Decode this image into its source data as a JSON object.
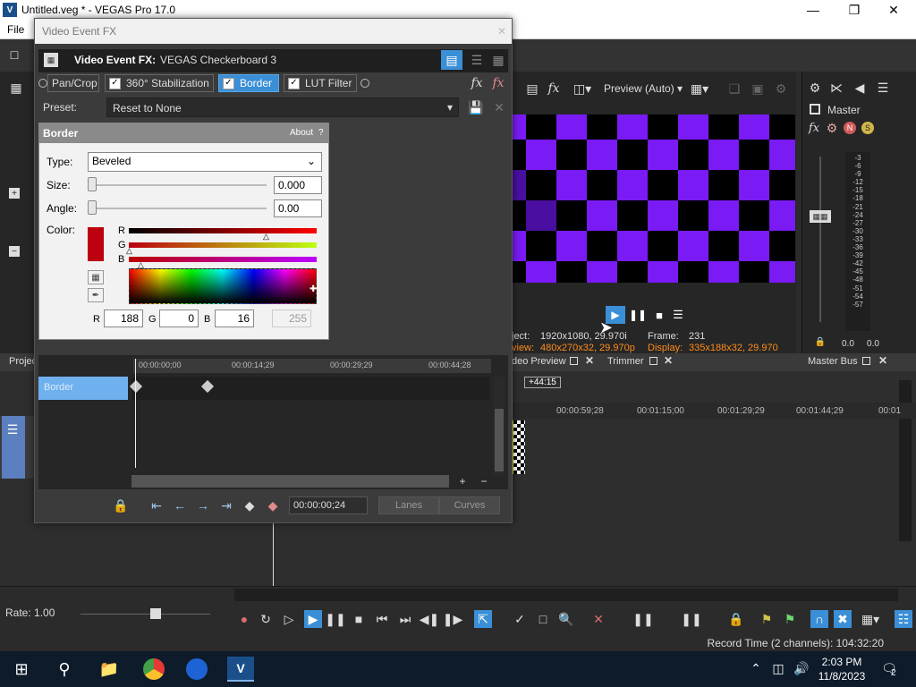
{
  "window": {
    "title": "Untitled.veg * - VEGAS Pro 17.0",
    "app_icon": "V",
    "minimize": "—",
    "maximize": "❐",
    "close": "✕"
  },
  "menu": {
    "file": "File"
  },
  "dialog": {
    "title": "Video Event FX",
    "fx_label": "Video Event FX:",
    "fx_name": "VEGAS Checkerboard 3",
    "chain": [
      {
        "label": "Pan/Crop",
        "checked": false
      },
      {
        "label": "360° Stabilization",
        "checked": true
      },
      {
        "label": "Border",
        "checked": true
      },
      {
        "label": "LUT Filter",
        "checked": true
      }
    ],
    "preset_label": "Preset:",
    "preset_value": "Reset to None",
    "border_panel": {
      "title": "Border",
      "about": "About",
      "help": "?",
      "type_label": "Type:",
      "type_value": "Beveled",
      "size_label": "Size:",
      "size_value": "0.000",
      "size_level": 0,
      "angle_label": "Angle:",
      "angle_value": "0.00",
      "angle_level": 0,
      "color_label": "Color:",
      "r_label": "R",
      "g_label": "G",
      "b_label": "B",
      "r_value": "188",
      "g_value": "0",
      "b_value": "16",
      "a_value": "255",
      "swatch_color": "#BC0010"
    },
    "keyframes": {
      "track_label": "Border",
      "t0": "00:00:00;00",
      "t1": "00:00:14;29",
      "t2": "00:00:29;29",
      "t3": "00:00:44;28",
      "time_display": "00:00:00;24",
      "lanes": "Lanes",
      "curves": "Curves"
    }
  },
  "preview": {
    "mode": "Preview (Auto)",
    "project_label": "ject:",
    "project_value": "1920x1080, 29.970i",
    "preview_label": "view:",
    "preview_value": "480x270x32, 29.970p",
    "frame_label": "Frame:",
    "frame_value": "231",
    "display_label": "Display:",
    "display_value": "335x188x32, 29.970"
  },
  "master": {
    "label": "Master",
    "scale": [
      "3",
      "6",
      "9",
      "12",
      "15",
      "18",
      "21",
      "24",
      "27",
      "30",
      "33",
      "36",
      "39",
      "42",
      "45",
      "48",
      "51",
      "54",
      "57"
    ],
    "left_val": "0.0",
    "right_val": "0.0"
  },
  "tabs": {
    "project": "Projec",
    "video_preview": "deo Preview",
    "trimmer": "Trimmer",
    "master_bus": "Master Bus"
  },
  "timeline": {
    "offset": "+44:15",
    "ruler": [
      "00:00:59;28",
      "00:01:15;00",
      "00:01:29;29",
      "00:01:44;29",
      "00:01"
    ]
  },
  "bottom": {
    "rate_label": "Rate: 1.00"
  },
  "status": {
    "record_time": "Record Time (2 channels): 104:32:20"
  },
  "taskbar": {
    "time": "2:03 PM",
    "date": "11/8/2023",
    "notif_count": "2"
  },
  "colors": {
    "accent": "#3A8FD6",
    "purple": "#7A1AF5",
    "dark_purple": "#4A0FA0"
  }
}
